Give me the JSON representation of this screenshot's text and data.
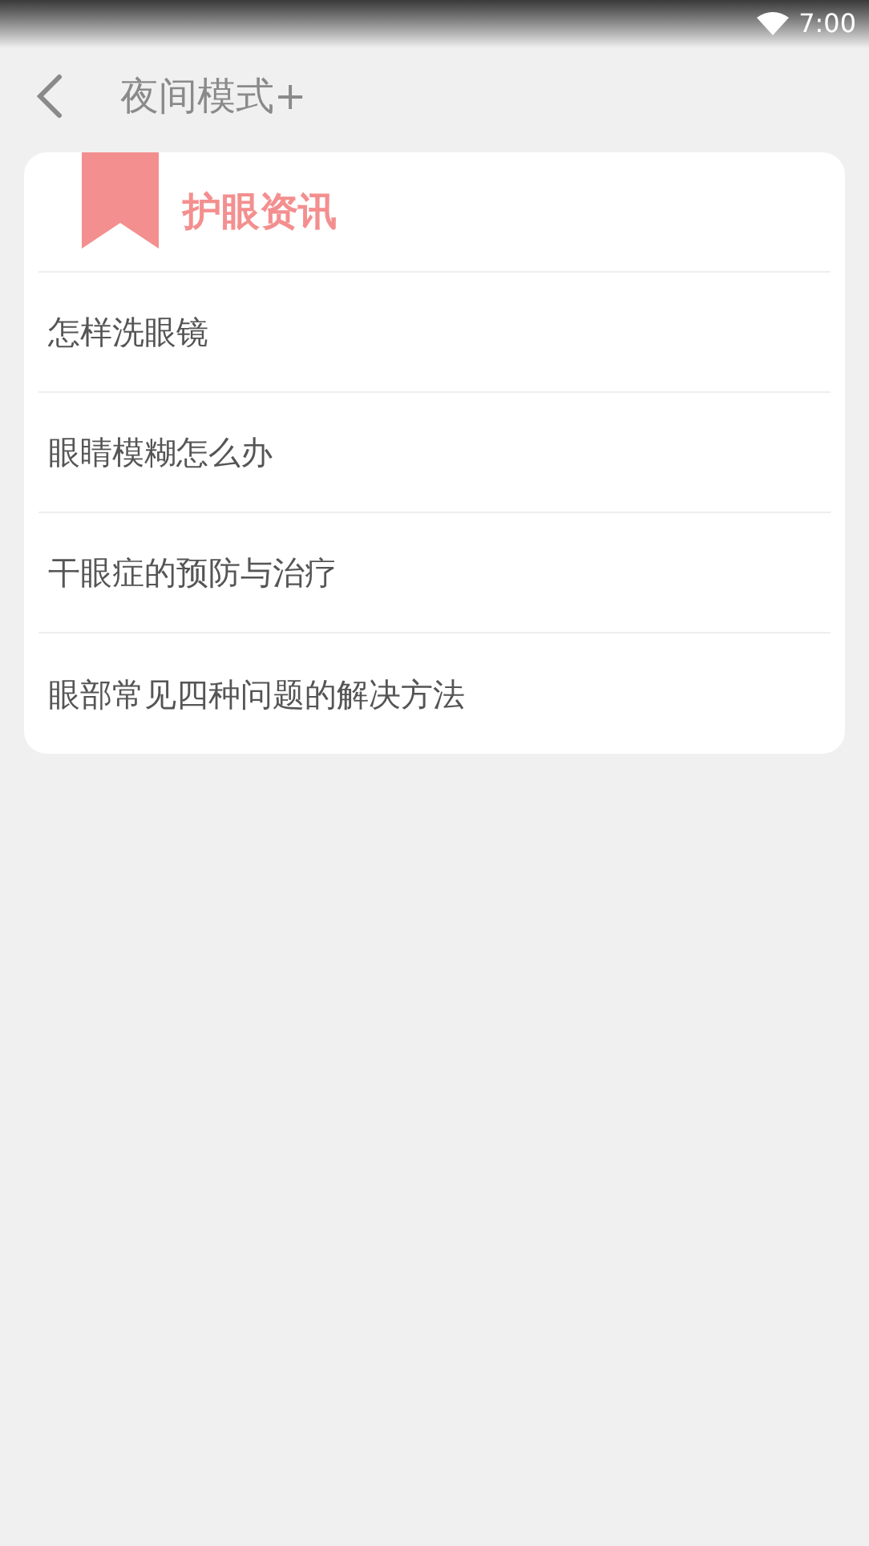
{
  "status_bar": {
    "time": "7:00"
  },
  "header": {
    "title": "夜间模式+"
  },
  "card": {
    "title": "护眼资讯",
    "items": [
      {
        "label": "怎样洗眼镜"
      },
      {
        "label": "眼睛模糊怎么办"
      },
      {
        "label": "干眼症的预防与治疗"
      },
      {
        "label": "眼部常见四种问题的解决方法"
      }
    ]
  }
}
